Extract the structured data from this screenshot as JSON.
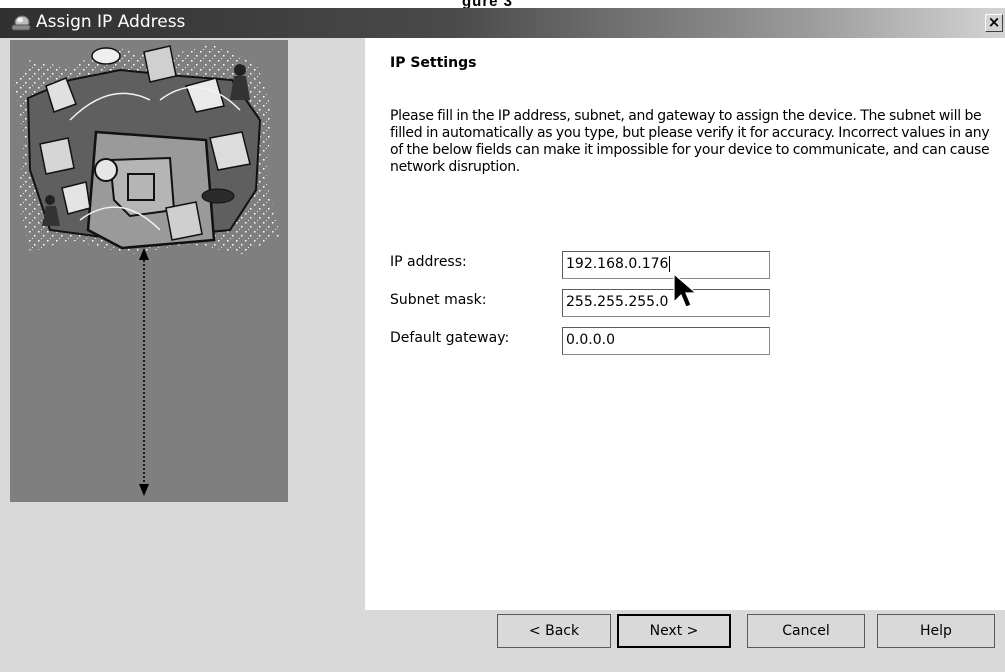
{
  "page_fragment": "gure 3",
  "window": {
    "title": "Assign IP Address",
    "close_glyph": "×"
  },
  "content": {
    "heading": "IP Settings",
    "description": "Please fill in the IP address, subnet, and gateway to assign the device. The subnet will be filled in automatically as you type, but please verify it for accuracy.  Incorrect values in any of the below fields can make it impossible for your device to communicate, and can cause network disruption.",
    "fields": [
      {
        "label": "IP address:",
        "value": "192.168.0.176"
      },
      {
        "label": "Subnet mask:",
        "value": "255.255.255.0"
      },
      {
        "label": "Default gateway:",
        "value": "0.0.0.0"
      }
    ]
  },
  "buttons": {
    "back": "< Back",
    "next": "Next >",
    "cancel": "Cancel",
    "help": "Help"
  },
  "icons": {
    "app": "network-wizard-icon",
    "close": "close-icon",
    "pointer": "mouse-pointer-icon",
    "arrow": "double-arrow-icon"
  }
}
